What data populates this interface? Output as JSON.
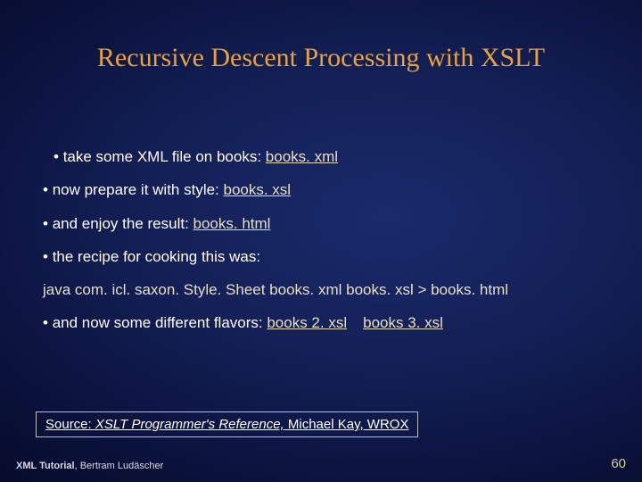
{
  "title": "Recursive Descent Processing with XSLT",
  "bullets": {
    "b1_pre": "take some XML file on books: ",
    "b1_link": "books. xml",
    "b2_pre": "now prepare it with style:  ",
    "b2_link": "books. xsl",
    "b3_pre": "and enjoy the result:  ",
    "b3_link": "books. html",
    "b4": "the recipe for cooking this was:",
    "cmd": "java com. icl. saxon. Style. Sheet books. xml books. xsl  > books. html",
    "b5_pre": "and now some different flavors:   ",
    "b5_link1": "books 2. xsl",
    "b5_link2": "books 3. xsl"
  },
  "source": {
    "prefix": "Source: ",
    "title": "XSLT Programmer's Reference,",
    "suffix": " Michael Kay, WROX"
  },
  "footer": {
    "series": "XML Tutorial",
    "author": ", Bertram Ludäscher",
    "page": "60"
  }
}
